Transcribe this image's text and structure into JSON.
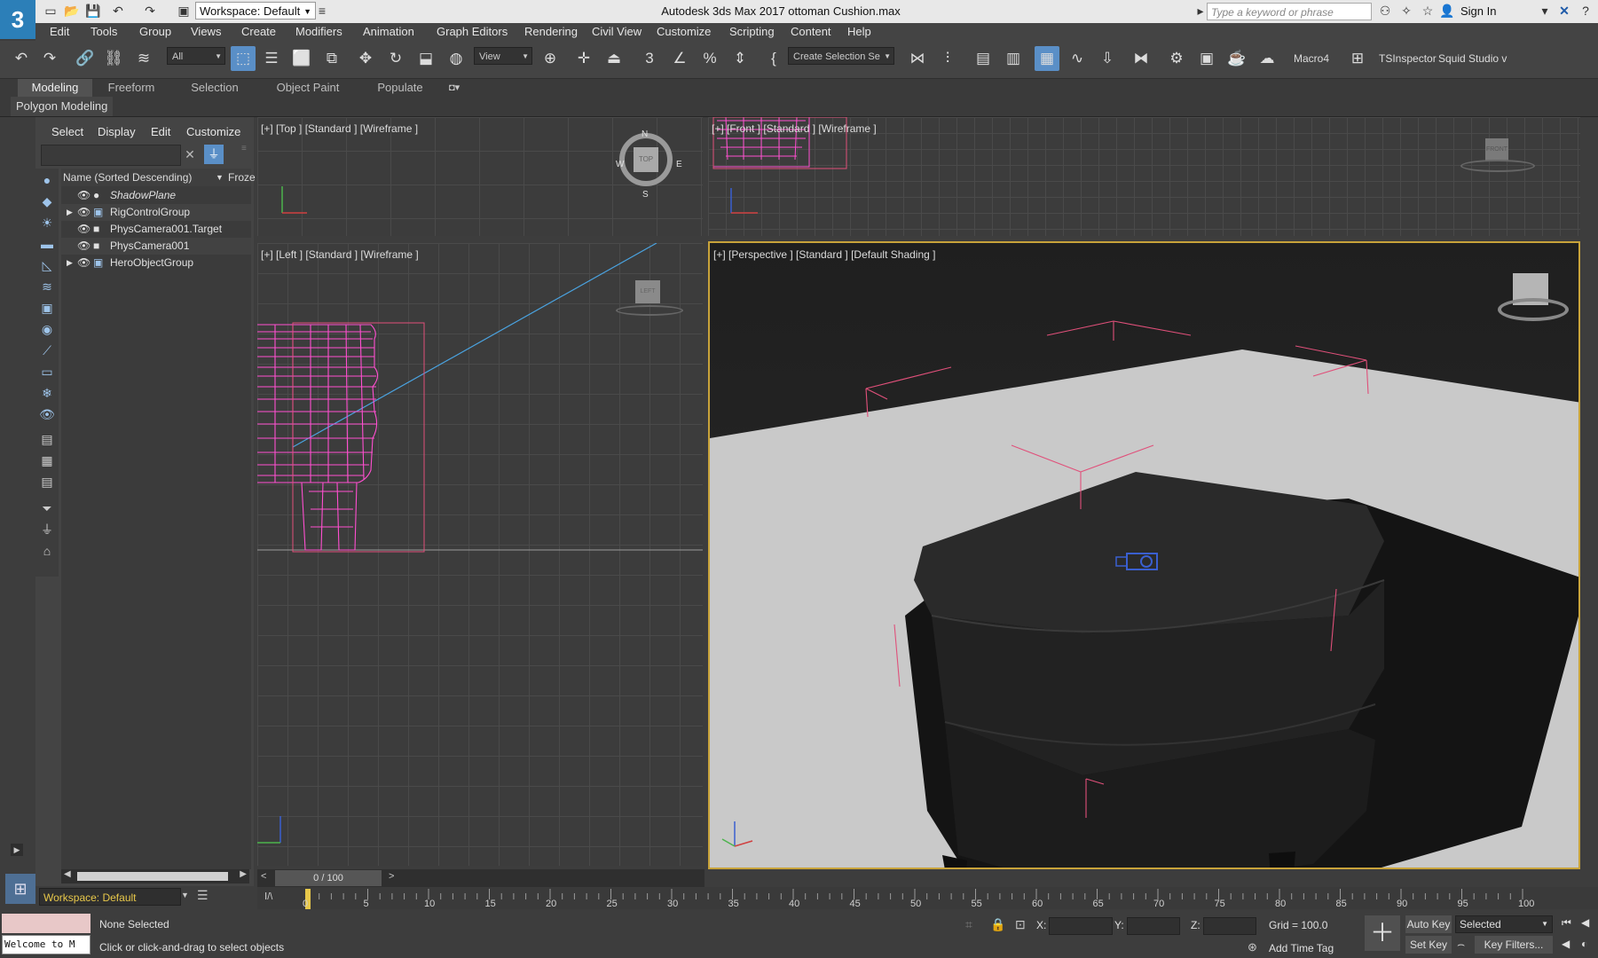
{
  "app": {
    "logo": "3",
    "title": "Autodesk 3ds Max 2017    ottoman Cushion.max",
    "workspace": "Workspace: Default",
    "search_placeholder": "Type a keyword or phrase",
    "sign_in": "Sign In"
  },
  "menu": [
    "Edit",
    "Tools",
    "Group",
    "Views",
    "Create",
    "Modifiers",
    "Animation",
    "Graph Editors",
    "Rendering",
    "Civil View",
    "Customize",
    "Scripting",
    "Content",
    "Help"
  ],
  "toolbar": {
    "filter": "All",
    "ref_coord": "View",
    "selection_set": "Create Selection Se",
    "macro": "Macro4",
    "tsinspector": "TSInspector",
    "squid": "Squid Studio v"
  },
  "ribbon": {
    "tabs": [
      "Modeling",
      "Freeform",
      "Selection",
      "Object Paint",
      "Populate"
    ],
    "active": "Modeling",
    "panel": "Polygon Modeling"
  },
  "explorer": {
    "tabs": [
      "Select",
      "Display",
      "Edit",
      "Customize"
    ],
    "column_name": "Name (Sorted Descending)",
    "column_frozen": "Froze",
    "items": [
      {
        "name": "ShadowPlane",
        "expandable": false,
        "italic": true
      },
      {
        "name": "RigControlGroup",
        "expandable": true,
        "italic": false
      },
      {
        "name": "PhysCamera001.Target",
        "expandable": false,
        "italic": false
      },
      {
        "name": "PhysCamera001",
        "expandable": false,
        "italic": false
      },
      {
        "name": "HeroObjectGroup",
        "expandable": true,
        "italic": false
      }
    ],
    "workspace": "Workspace: Default"
  },
  "viewports": {
    "top": "[+] [Top ] [Standard ] [Wireframe ]",
    "front": "[+] [Front ] [Standard ] [Wireframe ]",
    "left": "[+] [Left ] [Standard ] [Wireframe ]",
    "perspective": "[+] [Perspective ] [Standard ] [Default Shading ]",
    "compass": {
      "n": "N",
      "s": "S",
      "e": "E",
      "w": "W",
      "cube": "TOP"
    },
    "left_cube": "LEFT",
    "front_cube": "FRONT"
  },
  "timeline": {
    "frame": "0 / 100",
    "ticks": [
      "0",
      "5",
      "10",
      "15",
      "20",
      "25",
      "30",
      "35",
      "40",
      "45",
      "50",
      "55",
      "60",
      "65",
      "70",
      "75",
      "80",
      "85",
      "90",
      "95",
      "100"
    ]
  },
  "status": {
    "maxscript": "Welcome to M",
    "selected": "None Selected",
    "prompt": "Click or click-and-drag to select objects",
    "x_label": "X:",
    "y_label": "Y:",
    "z_label": "Z:",
    "grid": "Grid = 100.0",
    "add_time_tag": "Add Time Tag",
    "auto_key": "Auto Key",
    "set_key": "Set Key",
    "selected_drop": "Selected",
    "key_filters": "Key Filters..."
  },
  "colors": {
    "accent": "#5a8fc7",
    "wire": "#ff4fd0",
    "workspace_text": "#e8c84a",
    "bounding": "#e0507a"
  }
}
